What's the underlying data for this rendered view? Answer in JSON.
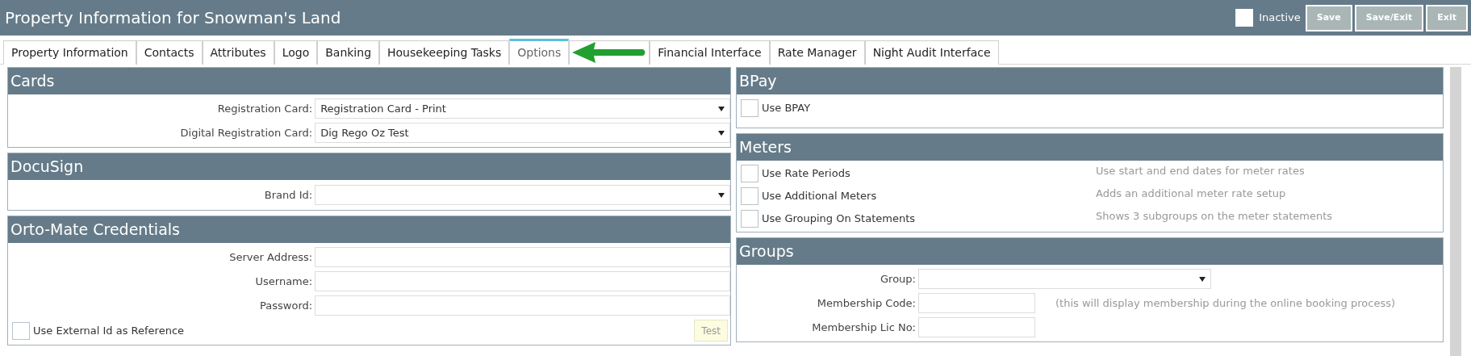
{
  "header": {
    "title": "Property Information for Snowman's Land",
    "inactive": {
      "label": "Inactive",
      "checked": false
    },
    "buttons": [
      "Save",
      "Save/Exit",
      "Exit"
    ]
  },
  "tabs": [
    {
      "label": "Property Information",
      "selected": false
    },
    {
      "label": "Contacts",
      "selected": false
    },
    {
      "label": "Attributes",
      "selected": false
    },
    {
      "label": "Logo",
      "selected": false
    },
    {
      "label": "Banking",
      "selected": false
    },
    {
      "label": "Housekeeping Tasks",
      "selected": false
    },
    {
      "label": "Options",
      "selected": true
    },
    {
      "kind": "covered"
    },
    {
      "label": "Financial Interface",
      "selected": false
    },
    {
      "label": "Rate Manager",
      "selected": false
    },
    {
      "label": "Night Audit Interface",
      "selected": false
    }
  ],
  "cards": {
    "title": "Cards",
    "fields": [
      {
        "label": "Registration Card:",
        "value": "Registration Card - Print"
      },
      {
        "label": "Digital Registration Card:",
        "value": "Dig Rego Oz Test"
      }
    ]
  },
  "docusign": {
    "title": "DocuSign",
    "fields": [
      {
        "label": "Brand Id:"
      }
    ]
  },
  "orto_mate": {
    "title": "Orto-Mate Credentials",
    "fields": [
      {
        "label": "Server Address:"
      },
      {
        "label": "Username:"
      },
      {
        "label": "Password:"
      }
    ],
    "use_external_id": {
      "label": "Use External Id as Reference",
      "checked": false
    },
    "test_button": "Test"
  },
  "bpay": {
    "title": "BPay",
    "options": [
      {
        "label": "Use BPAY",
        "checked": false
      }
    ]
  },
  "meters": {
    "title": "Meters",
    "options": [
      {
        "label": "Use Rate Periods",
        "checked": false,
        "hint": "Use start and end dates for meter rates"
      },
      {
        "label": "Use Additional Meters",
        "checked": false,
        "hint": "Adds an additional meter rate setup"
      },
      {
        "label": "Use Grouping On Statements",
        "checked": false,
        "hint": "Shows 3 subgroups on the meter statements"
      }
    ]
  },
  "groups": {
    "title": "Groups",
    "group_label": "Group:",
    "membership_code_label": "Membership Code:",
    "membership_code_note": "(this will display membership during the online booking process)",
    "membership_lic_label": "Membership Lic No:"
  }
}
